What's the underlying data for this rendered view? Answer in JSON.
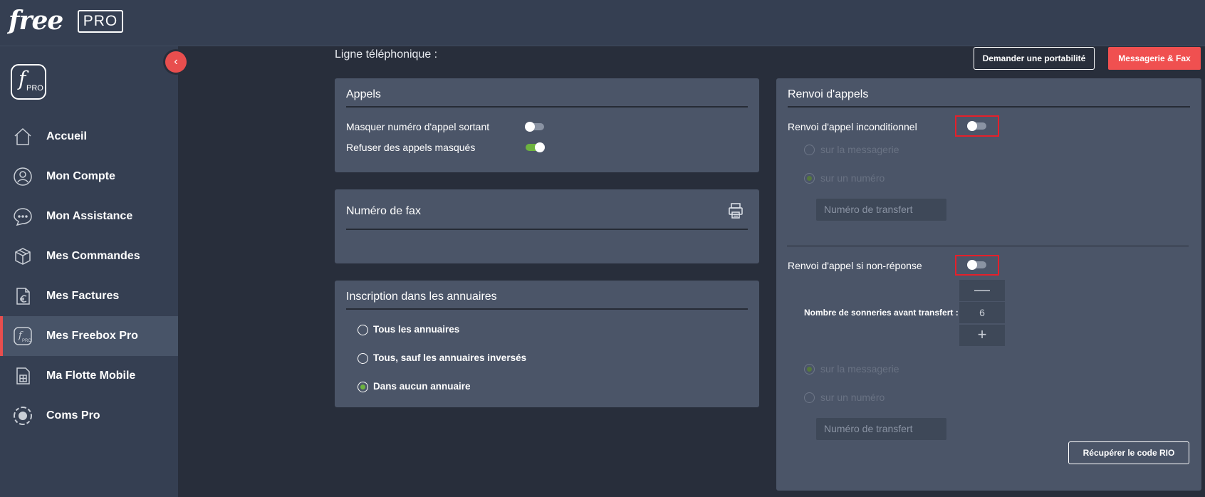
{
  "header": {
    "logo_text": "free",
    "logo_badge": "PRO"
  },
  "sidebar": {
    "logo_letter": "f",
    "logo_sub": "PRO",
    "items": [
      {
        "label": "Accueil",
        "icon": "home-icon"
      },
      {
        "label": "Mon Compte",
        "icon": "user-icon"
      },
      {
        "label": "Mon Assistance",
        "icon": "chat-icon"
      },
      {
        "label": "Mes Commandes",
        "icon": "box-icon"
      },
      {
        "label": "Mes Factures",
        "icon": "invoice-euro-icon"
      },
      {
        "label": "Mes Freebox Pro",
        "icon": "freebox-pro-icon",
        "active": true
      },
      {
        "label": "Ma Flotte Mobile",
        "icon": "sim-card-icon"
      },
      {
        "label": "Coms Pro",
        "icon": "coms-pro-icon"
      }
    ]
  },
  "main": {
    "title": "Ligne téléphonique :",
    "btn_portabilite": "Demander une portabilité",
    "btn_messagerie": "Messagerie & Fax"
  },
  "appels": {
    "title": "Appels",
    "rows": [
      {
        "label": "Masquer numéro d'appel sortant",
        "on": false
      },
      {
        "label": "Refuser des appels masqués",
        "on": true
      }
    ]
  },
  "fax": {
    "title": "Numéro de fax",
    "icon": "printer-icon"
  },
  "annuaires": {
    "title": "Inscription dans les annuaires",
    "options": [
      {
        "label": "Tous les annuaires",
        "checked": false
      },
      {
        "label": "Tous, sauf les annuaires inversés",
        "checked": false
      },
      {
        "label": "Dans aucun annuaire",
        "checked": true
      }
    ]
  },
  "renvoi": {
    "title": "Renvoi d'appels",
    "inconditionnel": {
      "label": "Renvoi d'appel inconditionnel",
      "on": false,
      "opt_messagerie": "sur la messagerie",
      "opt_numero": "sur un numéro",
      "selected": "numero",
      "placeholder": "Numéro de transfert"
    },
    "non_reponse": {
      "label": "Renvoi d'appel si non-réponse",
      "on": false,
      "sonneries_label": "Nombre de sonneries avant transfert :",
      "sonneries_value": "6",
      "minus": "—",
      "plus": "+",
      "opt_messagerie": "sur la messagerie",
      "opt_numero": "sur un numéro",
      "selected": "messagerie",
      "placeholder": "Numéro de transfert"
    },
    "btn_rio": "Récupérer le code RIO"
  },
  "colors": {
    "accent_red": "#f05050",
    "toggle_on": "#6db33f",
    "highlight": "#e5202a"
  }
}
